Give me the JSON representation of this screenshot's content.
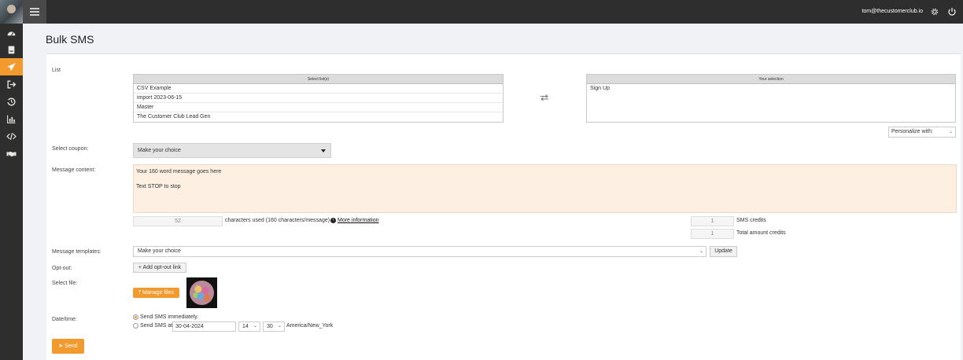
{
  "header": {
    "user_email": "tom@thecustomerclub.io"
  },
  "page": {
    "title": "Bulk SMS"
  },
  "colors": {
    "accent": "#f29a2e",
    "topbar": "#2e2e2e",
    "message_bg": "#fdf0e3"
  },
  "sidebar": {
    "items": [
      {
        "icon": "dashboard-icon",
        "active": false
      },
      {
        "icon": "book-icon",
        "active": false
      },
      {
        "icon": "paper-plane-icon",
        "active": true
      },
      {
        "icon": "sign-out-icon",
        "active": false
      },
      {
        "icon": "history-icon",
        "active": false
      },
      {
        "icon": "chart-icon",
        "active": false
      },
      {
        "icon": "code-icon",
        "active": false
      },
      {
        "icon": "handshake-icon",
        "active": false
      }
    ]
  },
  "list": {
    "label": "List",
    "select_header": "Select list(s)",
    "options": [
      "CSV Example",
      "import 2023-06-15",
      "Master",
      "The Customer Club Lead Gen"
    ],
    "selection_header": "Your selection",
    "selected": [
      "Sign Up"
    ]
  },
  "personalize": {
    "value": "Personalize with:"
  },
  "coupon": {
    "label": "Select coupon:",
    "value": "Make your choice"
  },
  "message": {
    "label": "Message content:",
    "value": "Your 160 word message goes here\n\nText STOP to stop",
    "char_count": "52",
    "chars_text": "characters used (160 characters/message)",
    "more_info": "More information"
  },
  "credits": {
    "sms_value": "1",
    "sms_label": "SMS credits",
    "total_value": "1",
    "total_label": "Total amount credits"
  },
  "templates": {
    "label": "Message templates:",
    "value": "Make your choice",
    "update_label": "Update"
  },
  "optout": {
    "label": "Opt-out:",
    "button": "Add opt-out link"
  },
  "file": {
    "label": "Select file:",
    "button": "Manage files"
  },
  "datetime": {
    "label": "Date/time:",
    "immediate": "Send SMS immediately.",
    "scheduled": "Send SMS at",
    "date": "30-04-2024",
    "hour": "14",
    "minute": "30",
    "timezone": "America/New_York"
  },
  "send": {
    "label": "Send"
  }
}
